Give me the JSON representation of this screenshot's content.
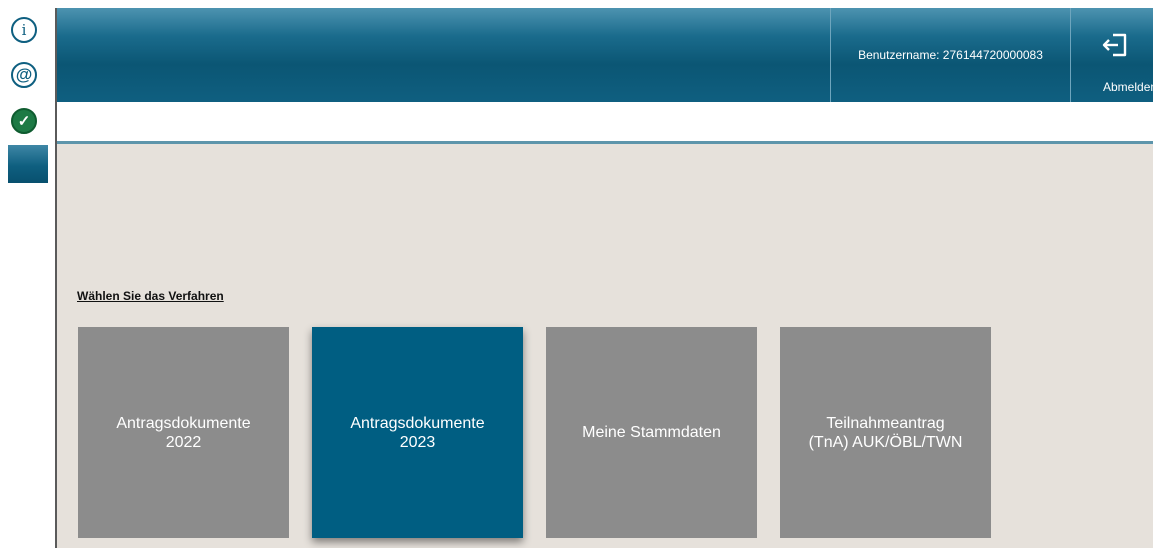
{
  "sidebar": {
    "icons": [
      {
        "name": "info-icon",
        "glyph": "i"
      },
      {
        "name": "at-icon",
        "glyph": "@"
      },
      {
        "name": "check-icon",
        "glyph": "✓"
      }
    ]
  },
  "header": {
    "username_text": "Benutzername: 276144720000083",
    "logout_label": "Abmelden"
  },
  "main": {
    "section_title": "Wählen Sie das Verfahren",
    "tiles": [
      {
        "label": "Antragsdokumente\n2022",
        "active": false
      },
      {
        "label": "Antragsdokumente\n2023",
        "active": true
      },
      {
        "label": "Meine Stammdaten",
        "active": false
      },
      {
        "label": "Teilnahmeantrag\n(TnA) AUK/ÖBL/TWN",
        "active": false
      }
    ]
  },
  "colors": {
    "header_blue": "#0f5f80",
    "tile_gray": "#8c8c8c",
    "tile_active": "#005e82",
    "content_bg": "#e6e1db",
    "check_green": "#1d7a45"
  }
}
